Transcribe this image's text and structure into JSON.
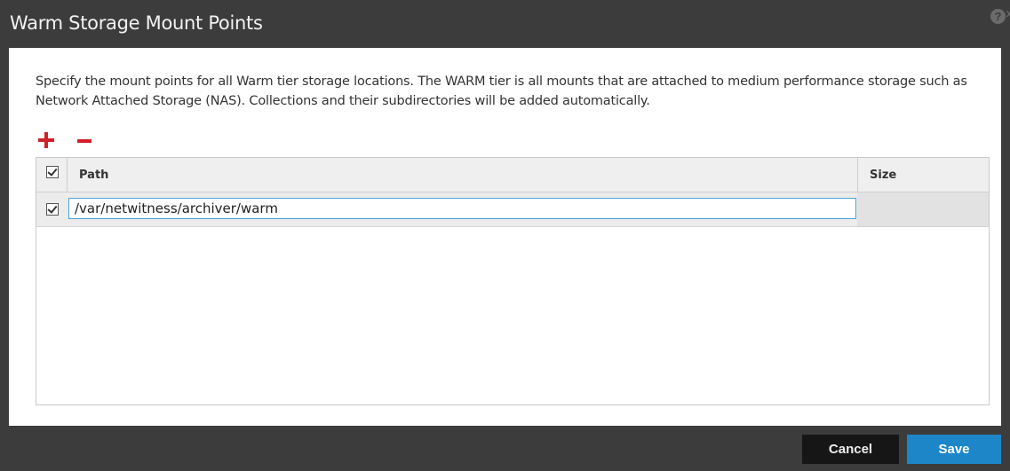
{
  "dialog": {
    "title": "Warm Storage Mount Points",
    "description": "Specify the mount points for all Warm tier storage locations. The WARM tier is all mounts that are attached to medium performance storage such as Network Attached Storage (NAS). Collections and their subdirectories will be added automatically."
  },
  "toolbar": {
    "add_icon": "plus-icon",
    "remove_icon": "minus-icon",
    "accent_color": "#d0202b"
  },
  "grid": {
    "columns": [
      "Path",
      "Size"
    ],
    "header_checked": true,
    "rows": [
      {
        "checked": true,
        "path": "/var/netwitness/archiver/warm",
        "size": ""
      }
    ]
  },
  "footer": {
    "cancel_label": "Cancel",
    "save_label": "Save",
    "save_color": "#1d86c9"
  },
  "icons": {
    "help": "help-icon",
    "help_glyph": "?",
    "close": "close-icon",
    "close_glyph": "×"
  }
}
